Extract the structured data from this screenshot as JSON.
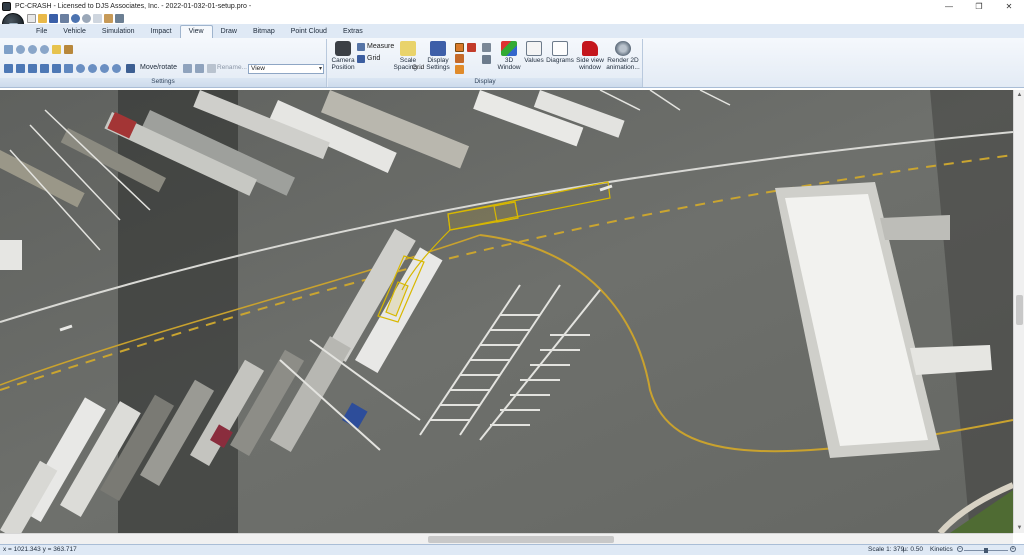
{
  "window": {
    "title": "PC-CRASH - Licensed to DJS Associates, Inc. - 2022-01-032-01-setup.pro -",
    "minimize": "—",
    "maximize": "❐",
    "close": "✕"
  },
  "tabs": [
    "File",
    "Vehicle",
    "Simulation",
    "Impact",
    "View",
    "Draw",
    "Bitmap",
    "Point Cloud",
    "Extras"
  ],
  "active_tab": "View",
  "ribbon": {
    "settings_group_label": "Settings",
    "display_group_label": "Display",
    "move_rotate": "Move/rotate",
    "rename": "Rename...",
    "view_select_value": "View",
    "camera_position": [
      "Camera",
      "Position"
    ],
    "measure": "Measure",
    "grid": "Grid",
    "scale_spacing": [
      "Scale",
      "Spacing..."
    ],
    "grid_short": "Grid",
    "display_settings": [
      "Display",
      "Settings"
    ],
    "window_3d": [
      "3D",
      "Window"
    ],
    "values": "Values",
    "diagrams": "Diagrams",
    "side_view": [
      "Side view",
      "window"
    ],
    "render_2d": [
      "Render 2D",
      "animation..."
    ]
  },
  "statusbar": {
    "coords": "x = 1021.343 y = 363.717",
    "scale": "Scale 1: 379",
    "mu": "µ: 0.50",
    "mode": "Kinetics"
  },
  "colors": {
    "accent_tab_bar": "#dfe9f5",
    "vehicle_outline": "#d8b800",
    "asphalt": "#6b6d6a"
  },
  "icons": {
    "camera": "camera-icon",
    "measure": "measure-icon",
    "grid": "grid-icon",
    "chart": "chart-icon",
    "car": "car-icon",
    "film": "film-reel-icon"
  }
}
